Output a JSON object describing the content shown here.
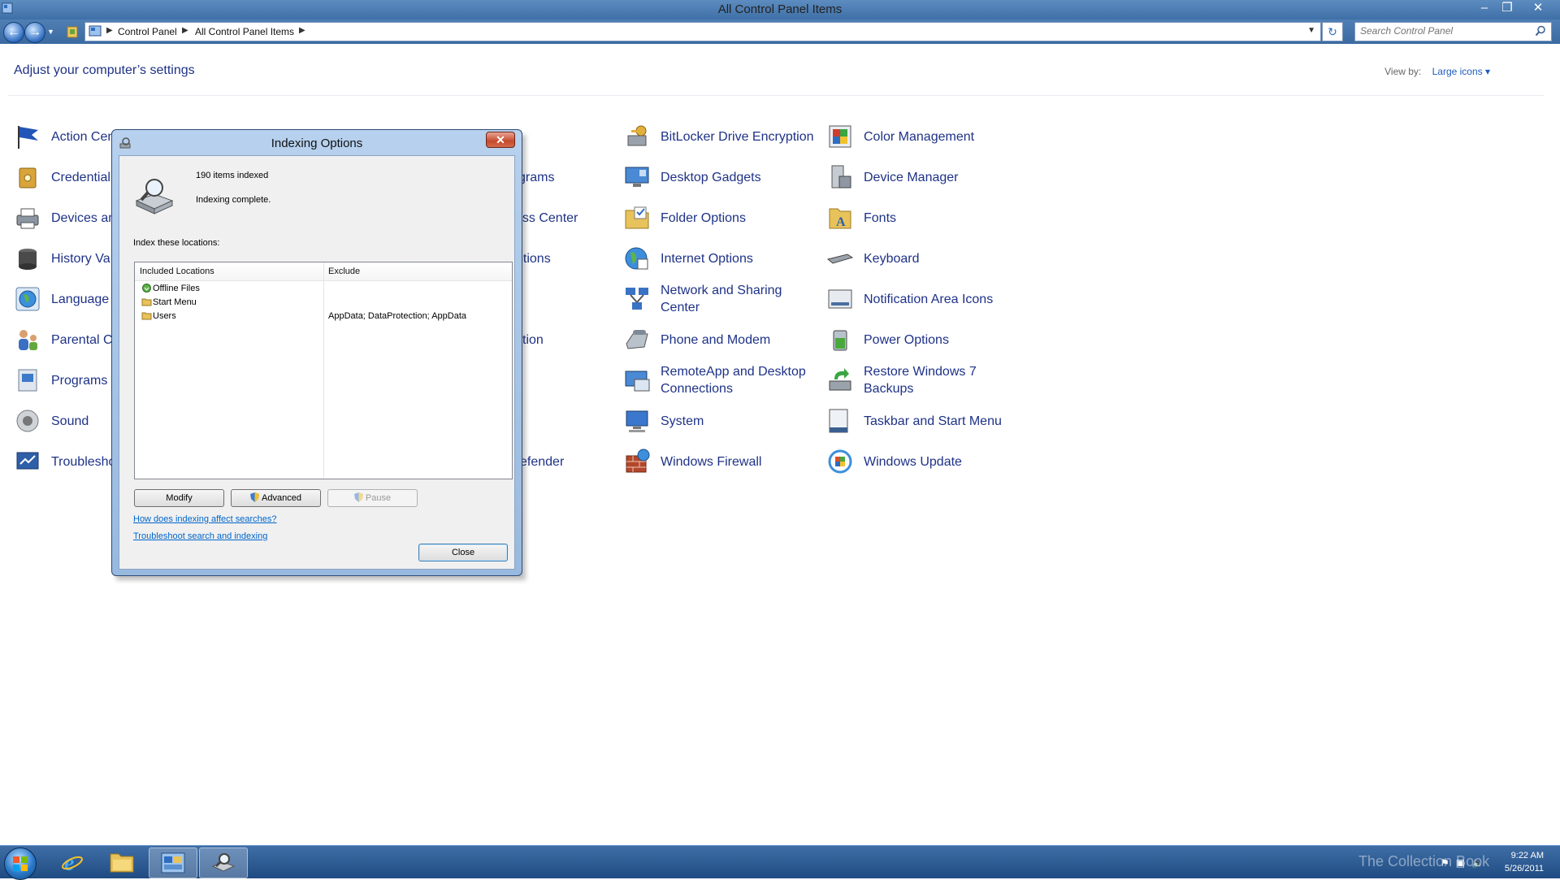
{
  "window": {
    "title": "All Control Panel Items"
  },
  "address": {
    "crumbs": [
      "Control Panel",
      "All Control Panel Items"
    ],
    "search_placeholder": "Search Control Panel"
  },
  "header": {
    "heading": "Adjust your computer’s settings",
    "view_by_label": "View by:",
    "view_by_value": "Large icons"
  },
  "items": {
    "action_center": "Action Cen",
    "credential": "Credential",
    "devices": "Devices an",
    "history": "History Va",
    "language": "Language",
    "parental": "Parental Co",
    "programs": "Programs a",
    "sound": "Sound",
    "troubleshoot": "Troublesho",
    "col2_programs": "grams",
    "col2_access": "ess Center",
    "col2_options": "otions",
    "col2_ion": "tion",
    "col2_defender": "efender",
    "bitlocker": "BitLocker Drive Encryption",
    "gadgets": "Desktop Gadgets",
    "folder": "Folder Options",
    "internet": "Internet Options",
    "network": "Network and Sharing Center",
    "phone": "Phone and Modem",
    "remoteapp": "RemoteApp and Desktop Connections",
    "system": "System",
    "firewall": "Windows Firewall",
    "color": "Color Management",
    "device_mgr": "Device Manager",
    "fonts": "Fonts",
    "keyboard": "Keyboard",
    "notification": "Notification Area Icons",
    "power": "Power Options",
    "restore": "Restore Windows 7 Backups",
    "taskbar": "Taskbar and Start Menu",
    "update": "Windows Update"
  },
  "dialog": {
    "title": "Indexing Options",
    "count": "190 items indexed",
    "status": "Indexing complete.",
    "index_label": "Index these locations:",
    "col_included": "Included Locations",
    "col_exclude": "Exclude",
    "rows": [
      {
        "name": "Offline Files",
        "exclude": ""
      },
      {
        "name": "Start Menu",
        "exclude": ""
      },
      {
        "name": "Users",
        "exclude": "AppData; DataProtection; AppData"
      }
    ],
    "btn_modify": "Modify",
    "btn_advanced": "Advanced",
    "btn_pause": "Pause",
    "link_how": "How does indexing affect searches?",
    "link_troubleshoot": "Troubleshoot search and indexing",
    "btn_close": "Close"
  },
  "tray": {
    "time": "9:22 AM",
    "date": "5/26/2011",
    "watermark": "The Collection Book"
  }
}
